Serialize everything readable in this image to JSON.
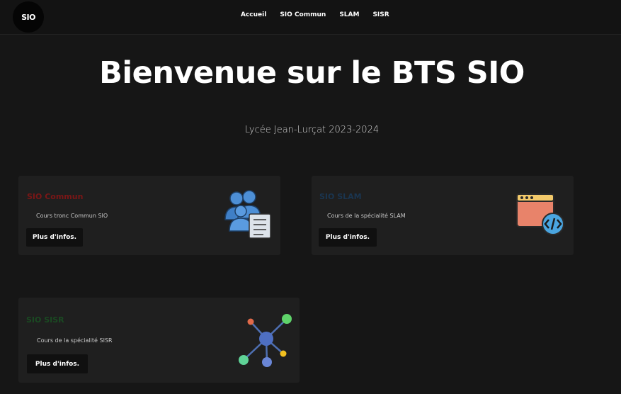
{
  "navbar": {
    "logo_text": "SIO",
    "links": [
      {
        "label": "Accueil"
      },
      {
        "label": "SIO Commun"
      },
      {
        "label": "SLAM"
      },
      {
        "label": "SISR"
      }
    ]
  },
  "hero": {
    "title": "Bienvenue sur le BTS SIO",
    "subtitle": "Lycée Jean-Lurçat 2023-2024"
  },
  "cards": [
    {
      "title": "SIO Commun",
      "title_color": "#7a1616",
      "description": "Cours tronc Commun SIO",
      "button_label": "Plus d'infos.",
      "icon": "users-checklist-icon"
    },
    {
      "title": "SIO SLAM",
      "title_color": "#1a3550",
      "description": "Cours de la spécialité SLAM",
      "button_label": "Plus d'infos.",
      "icon": "code-window-icon"
    },
    {
      "title": "SIO SISR",
      "title_color": "#1a4a22",
      "description": "Cours de la spécialité SISR",
      "button_label": "Plus d'infos.",
      "icon": "network-nodes-icon"
    }
  ]
}
